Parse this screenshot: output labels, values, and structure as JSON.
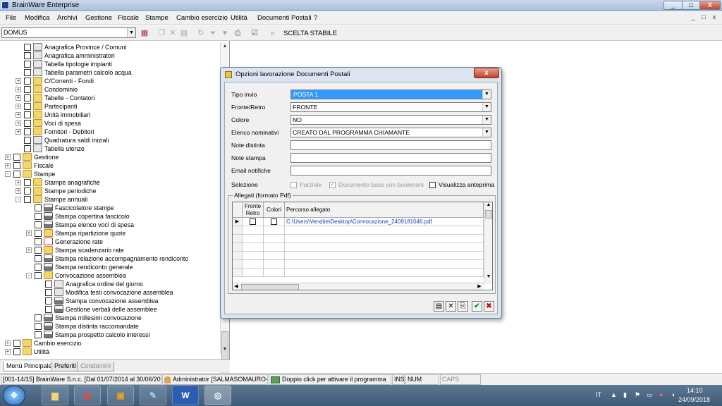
{
  "window": {
    "title": "BrainWare Enterprise",
    "controls": [
      "_",
      "□",
      "X"
    ]
  },
  "menu": [
    "File",
    "Modifica",
    "Archivi",
    "Gestione",
    "Fiscale",
    "Stampe",
    "Cambio esercizio",
    "Utilità",
    "Documenti Postali",
    "?"
  ],
  "menu_controls": [
    "_",
    "□",
    "x"
  ],
  "toolbar": {
    "stabile": "DOMUS",
    "scelta_stabile": "SCELTA STABILE"
  },
  "tree": [
    {
      "d": 2,
      "e": "",
      "t": "doc",
      "label": "Anagrafica Province / Comuni"
    },
    {
      "d": 2,
      "e": "",
      "t": "doc",
      "label": "Anagrafica amministratori"
    },
    {
      "d": 2,
      "e": "",
      "t": "doc",
      "label": "Tabella tipologie impianti"
    },
    {
      "d": 2,
      "e": "",
      "t": "doc",
      "label": "Tabella parametri calcolo acqua"
    },
    {
      "d": 2,
      "e": "+",
      "t": "folder",
      "label": "C/Correnti - Fondi"
    },
    {
      "d": 2,
      "e": "+",
      "t": "folder",
      "label": "Condominio"
    },
    {
      "d": 2,
      "e": "+",
      "t": "folder",
      "label": "Tabelle - Contatori"
    },
    {
      "d": 2,
      "e": "+",
      "t": "folder",
      "label": "Partecipanti"
    },
    {
      "d": 2,
      "e": "+",
      "t": "folder",
      "label": "Unità immobiliari"
    },
    {
      "d": 2,
      "e": "+",
      "t": "folder",
      "label": "Voci di spesa"
    },
    {
      "d": 2,
      "e": "+",
      "t": "folder",
      "label": "Fornitori - Debitori"
    },
    {
      "d": 2,
      "e": "",
      "t": "doc",
      "label": "Quadratura saldi iniziali"
    },
    {
      "d": 2,
      "e": "",
      "t": "doc",
      "label": "Tabella utenze"
    },
    {
      "d": 1,
      "e": "+",
      "t": "folder",
      "label": "Gestione"
    },
    {
      "d": 1,
      "e": "+",
      "t": "folder",
      "label": "Fiscale"
    },
    {
      "d": 1,
      "e": "-",
      "t": "folder",
      "label": "Stampe"
    },
    {
      "d": 2,
      "e": "+",
      "t": "folder",
      "label": "Stampe anagrafiche"
    },
    {
      "d": 2,
      "e": "+",
      "t": "folder",
      "label": "Stampe periodiche"
    },
    {
      "d": 2,
      "e": "-",
      "t": "folder",
      "label": "Stampe annuali"
    },
    {
      "d": 3,
      "e": "",
      "t": "print",
      "label": "Fascicolatore stampe"
    },
    {
      "d": 3,
      "e": "",
      "t": "print",
      "label": "Stampa copertina fascicolo"
    },
    {
      "d": 3,
      "e": "",
      "t": "print",
      "label": "Stampa elenco voci di spesa"
    },
    {
      "d": 3,
      "e": "+",
      "t": "folder",
      "label": "Stampa ripartizione quote"
    },
    {
      "d": 3,
      "e": "",
      "t": "special",
      "label": "Generazione rate"
    },
    {
      "d": 3,
      "e": "+",
      "t": "folder",
      "label": "Stampa scadenzario rate"
    },
    {
      "d": 3,
      "e": "",
      "t": "print",
      "label": "Stampa relazione accompagnamento rendiconto"
    },
    {
      "d": 3,
      "e": "",
      "t": "print",
      "label": "Stampa rendiconto generale"
    },
    {
      "d": 3,
      "e": "-",
      "t": "folder",
      "label": "Convocazione assemblea"
    },
    {
      "d": 4,
      "e": "",
      "t": "doc",
      "label": "Anagrafica ordine del giorno"
    },
    {
      "d": 4,
      "e": "",
      "t": "doc",
      "label": "Modifica testi convocazione assemblea"
    },
    {
      "d": 4,
      "e": "",
      "t": "print",
      "label": "Stampa convocazione assemblea"
    },
    {
      "d": 4,
      "e": "",
      "t": "print",
      "label": "Gestione verbali delle assemblee"
    },
    {
      "d": 3,
      "e": "",
      "t": "print",
      "label": "Stampa millesimi convocazione"
    },
    {
      "d": 3,
      "e": "",
      "t": "print",
      "label": "Stampa distinta raccomandate"
    },
    {
      "d": 3,
      "e": "",
      "t": "print",
      "label": "Stampa prospetto calcolo interessi"
    },
    {
      "d": 1,
      "e": "+",
      "t": "folder",
      "label": "Cambio esercizio"
    },
    {
      "d": 1,
      "e": "+",
      "t": "folder",
      "label": "Utilità"
    }
  ],
  "tree_scroll": [
    "▲",
    "▼"
  ],
  "tabs": [
    {
      "label": "Menù Principale",
      "state": "active"
    },
    {
      "label": "Preferiti",
      "state": "normal"
    },
    {
      "label": "Condomini",
      "state": "disabled"
    }
  ],
  "dialog": {
    "title": "Opzioni lavorazione Documenti Postali",
    "close": "x",
    "fields": [
      {
        "label": "Tipo invio",
        "value": "POSTA 1",
        "kind": "select",
        "selected": true
      },
      {
        "label": "Fronte/Retro",
        "value": "FRONTE",
        "kind": "select"
      },
      {
        "label": "Colore",
        "value": "NO",
        "kind": "select"
      },
      {
        "label": "Elenco nominativi",
        "value": "CREATO DAL PROGRAMMA CHIAMANTE",
        "kind": "select"
      },
      {
        "label": "Note distinta",
        "value": "",
        "kind": "text"
      },
      {
        "label": "Note stampa",
        "value": "",
        "kind": "text"
      },
      {
        "label": "Email notifiche",
        "value": "",
        "kind": "text"
      }
    ],
    "selezione_label": "Selezione",
    "checks": [
      {
        "label": "Parziale",
        "checked": false,
        "disabled": true
      },
      {
        "label": "Documento base con bookmark",
        "checked": true,
        "disabled": true
      },
      {
        "label": "Visualizza anteprima",
        "checked": false,
        "disabled": false
      }
    ],
    "allegati": {
      "title": "Allegati (formato Pdf)",
      "headers": [
        "Fronte Retro",
        "Colori",
        "Percorso allegato"
      ],
      "rows": [
        {
          "fronte": false,
          "colori": false,
          "path": "C:\\Users\\Vendite\\Desktop\\Convocazione_2409181046.pdf"
        }
      ]
    },
    "buttons": [
      "new",
      "delete",
      "attach",
      "ok",
      "cancel"
    ]
  },
  "status": [
    "[001-14/15] BrainWare S.n.c. [Dal 01/07/2014 al 30/06/2015]",
    "Administrator [SALMASOMAURO-PC]",
    "Doppio click per attivare il programma",
    "INS",
    "NUM",
    "CAPS"
  ],
  "taskbar": {
    "lang": "IT",
    "time": "14:10",
    "date": "24/09/2018"
  }
}
